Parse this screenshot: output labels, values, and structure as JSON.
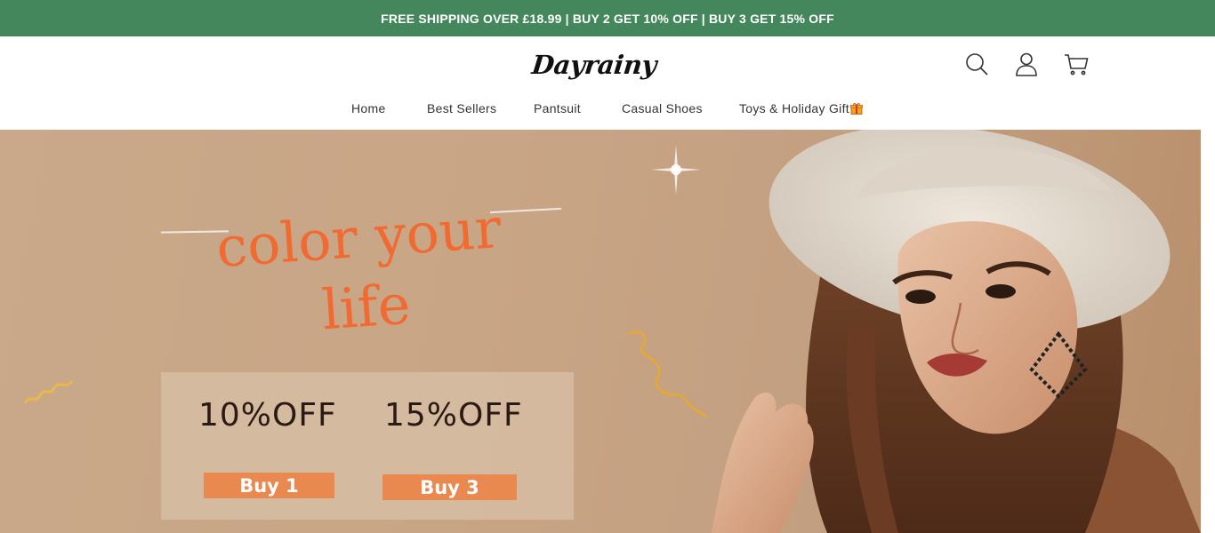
{
  "colors": {
    "announcement_bg": "#44875c",
    "headline": "#f06a32",
    "buy_button": "#e9884f",
    "hero_bg": "#c8a585"
  },
  "announcement": {
    "text": "FREE SHIPPING OVER £18.99 | BUY 2 GET 10% OFF | BUY 3 GET 15% OFF"
  },
  "header": {
    "logo_text": "Dayrainy",
    "icons": [
      "search-icon",
      "account-icon",
      "cart-icon"
    ]
  },
  "nav": {
    "items": [
      {
        "label": "Home"
      },
      {
        "label": "Best Sellers"
      },
      {
        "label": "Pantsuit"
      },
      {
        "label": "Casual Shoes"
      },
      {
        "label": "Toys & Holiday Gift",
        "icon": "gift-icon"
      }
    ]
  },
  "hero": {
    "headline_line1": "color your",
    "headline_line2": "life",
    "offers": [
      {
        "discount": "10%OFF",
        "button_label": "Buy 1"
      },
      {
        "discount": "15%OFF",
        "button_label": "Buy 3"
      }
    ]
  }
}
